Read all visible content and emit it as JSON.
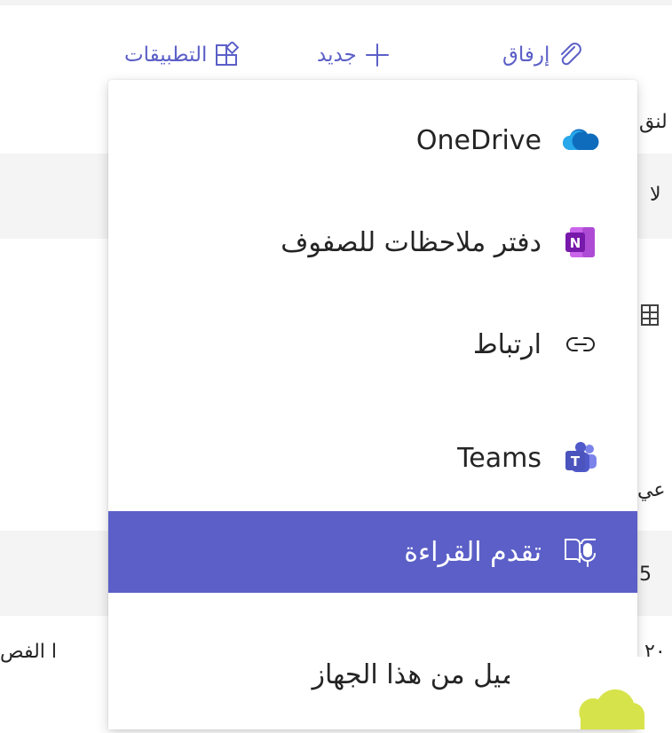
{
  "toolbar": {
    "attach_label": "إرفاق",
    "new_label": "جديد",
    "apps_label": "التطبيقات"
  },
  "background": {
    "row1_text": "لنق",
    "row2_text": "لا",
    "row3_text": "عي",
    "row4_text": "5",
    "row5_text": "ا الفص",
    "row6_text": "٢٠"
  },
  "menu": {
    "items": [
      {
        "label": "OneDrive",
        "icon": "onedrive-icon"
      },
      {
        "label": "دفتر ملاحظات للصفوف",
        "icon": "onenote-class-notebook-icon"
      },
      {
        "label": "ارتباط",
        "icon": "link-icon"
      },
      {
        "label": "Teams",
        "icon": "teams-icon"
      },
      {
        "label": "تقدم القراءة",
        "icon": "reading-progress-icon",
        "selected": true
      },
      {
        "label": "تحميل من هذا الجهاز",
        "icon": "upload-icon"
      }
    ]
  },
  "colors": {
    "accent": "#5b5fc7",
    "onedrive": "#0f6cbd",
    "onenote": "#7719aa",
    "teams": "#4b53bc",
    "lime": "#d7e34b"
  }
}
